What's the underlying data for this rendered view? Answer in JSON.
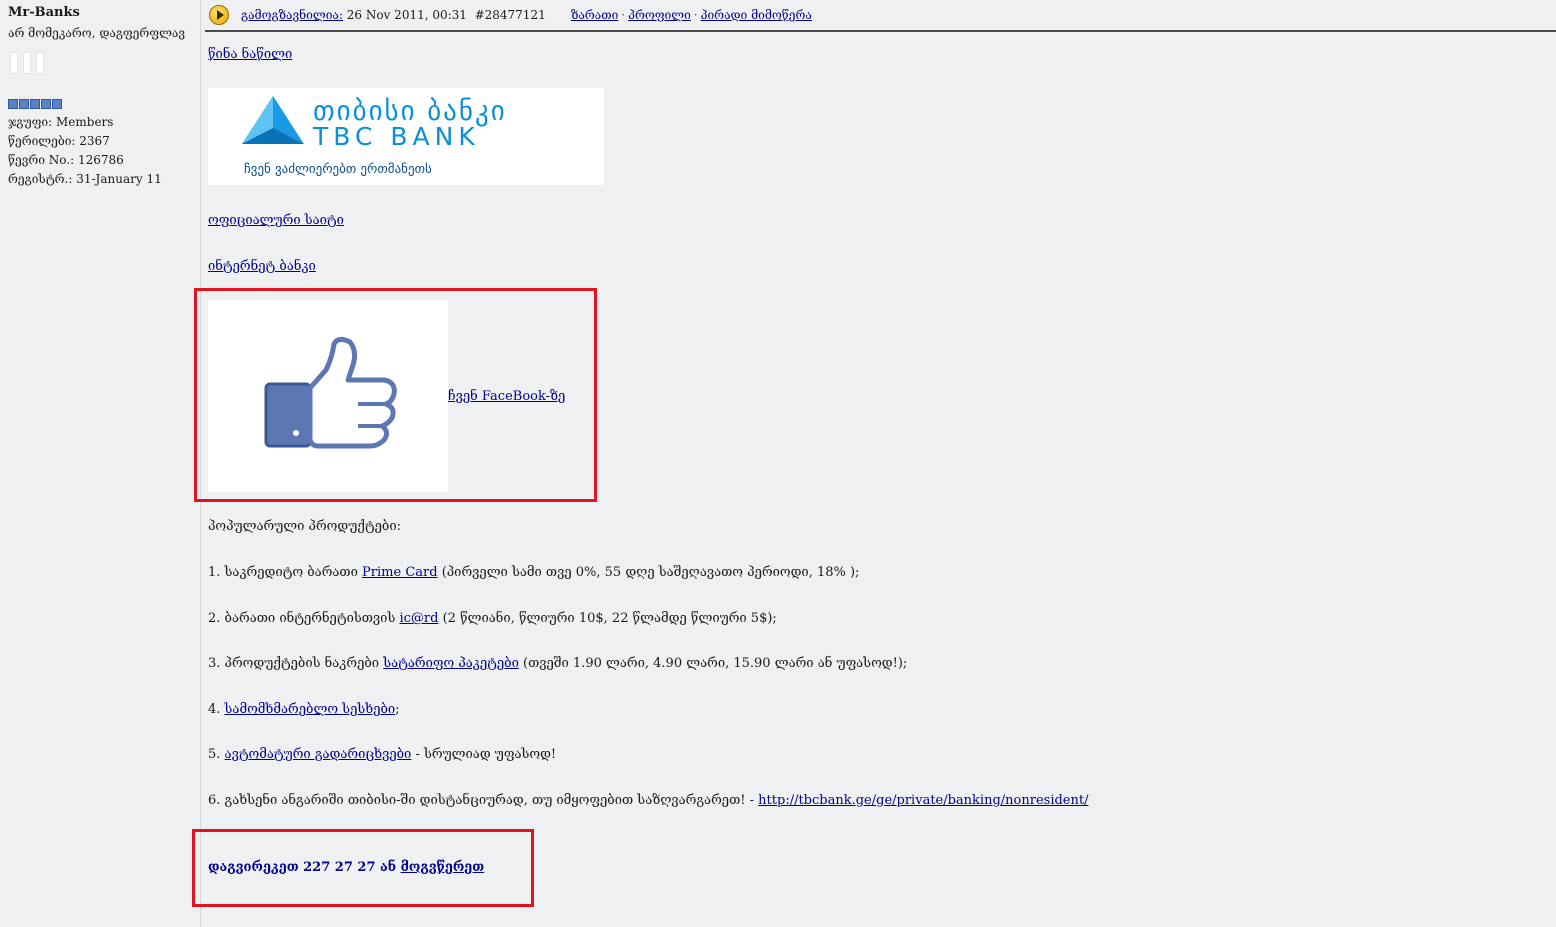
{
  "user": {
    "name": "Mr-Banks",
    "title": "არ მომეკარო, დაგფერფლავ",
    "group": "ჯგუფი: Members",
    "posts": "წერილები: 2367",
    "member_no": "წევრი No.: 126786",
    "registered": "რეგისტრ.: 31-January 11"
  },
  "header": {
    "sent_label": "გამოგზავნილია:",
    "date": "26 Nov 2011, 00:31",
    "post_id": "#28477121",
    "links": [
      "ზარათი",
      "პროფილი",
      "პირადი მიმოწერა"
    ]
  },
  "post": {
    "prev_part": "წინა ნაწილი",
    "logo": {
      "geo": "თიბისი ბანკი",
      "en": "TBC BANK",
      "slogan": "ჩვენ ვაძლიერებთ ერთმანეთს"
    },
    "official_site": "ოფიციალური საიტი",
    "internet_bank": "ინტერნეტ ბანკი",
    "facebook_link": "ჩვენ FaceBook-ზე",
    "popular_title": "პოპულარული პროდუქტები:",
    "items": [
      {
        "pre": "1. საკრედიტო ბარათი ",
        "link": "Prime Card",
        "post": " (პირველი სამი თვე 0%, 55 დღე საშეღავათო პერიოდი, 18% );"
      },
      {
        "pre": "2. ბარათი ინტერნეტისთვის ",
        "link": "ic@rd",
        "post": " (2 წლიანი, წლიური 10$, 22 წლამდე წლიური 5$);"
      },
      {
        "pre": "3. პროდუქტების ნაკრები ",
        "link": "სატარიფო პაკეტები",
        "post": " (თვეში 1.90 ლარი, 4.90 ლარი, 15.90 ლარი ან უფასოდ!);"
      },
      {
        "pre": "4. ",
        "link": "სამომხმარებლო სესხები",
        "post": ";"
      },
      {
        "pre": "5. ",
        "link": "ავტომატური გადარიცხვები",
        "post": " - სრულიად უფასოდ!"
      },
      {
        "pre": "6. გახსენი ანგარიში თიბისი-ში დისტანციურად, თუ იმყოფებით საზღვარგარეთ! - ",
        "link": "http://tbcbank.ge/ge/private/banking/nonresident/",
        "post": ""
      }
    ],
    "call_text": "დაგვირეკეთ 227 27 27 ან ",
    "call_link": "მოგვწერეთ"
  }
}
